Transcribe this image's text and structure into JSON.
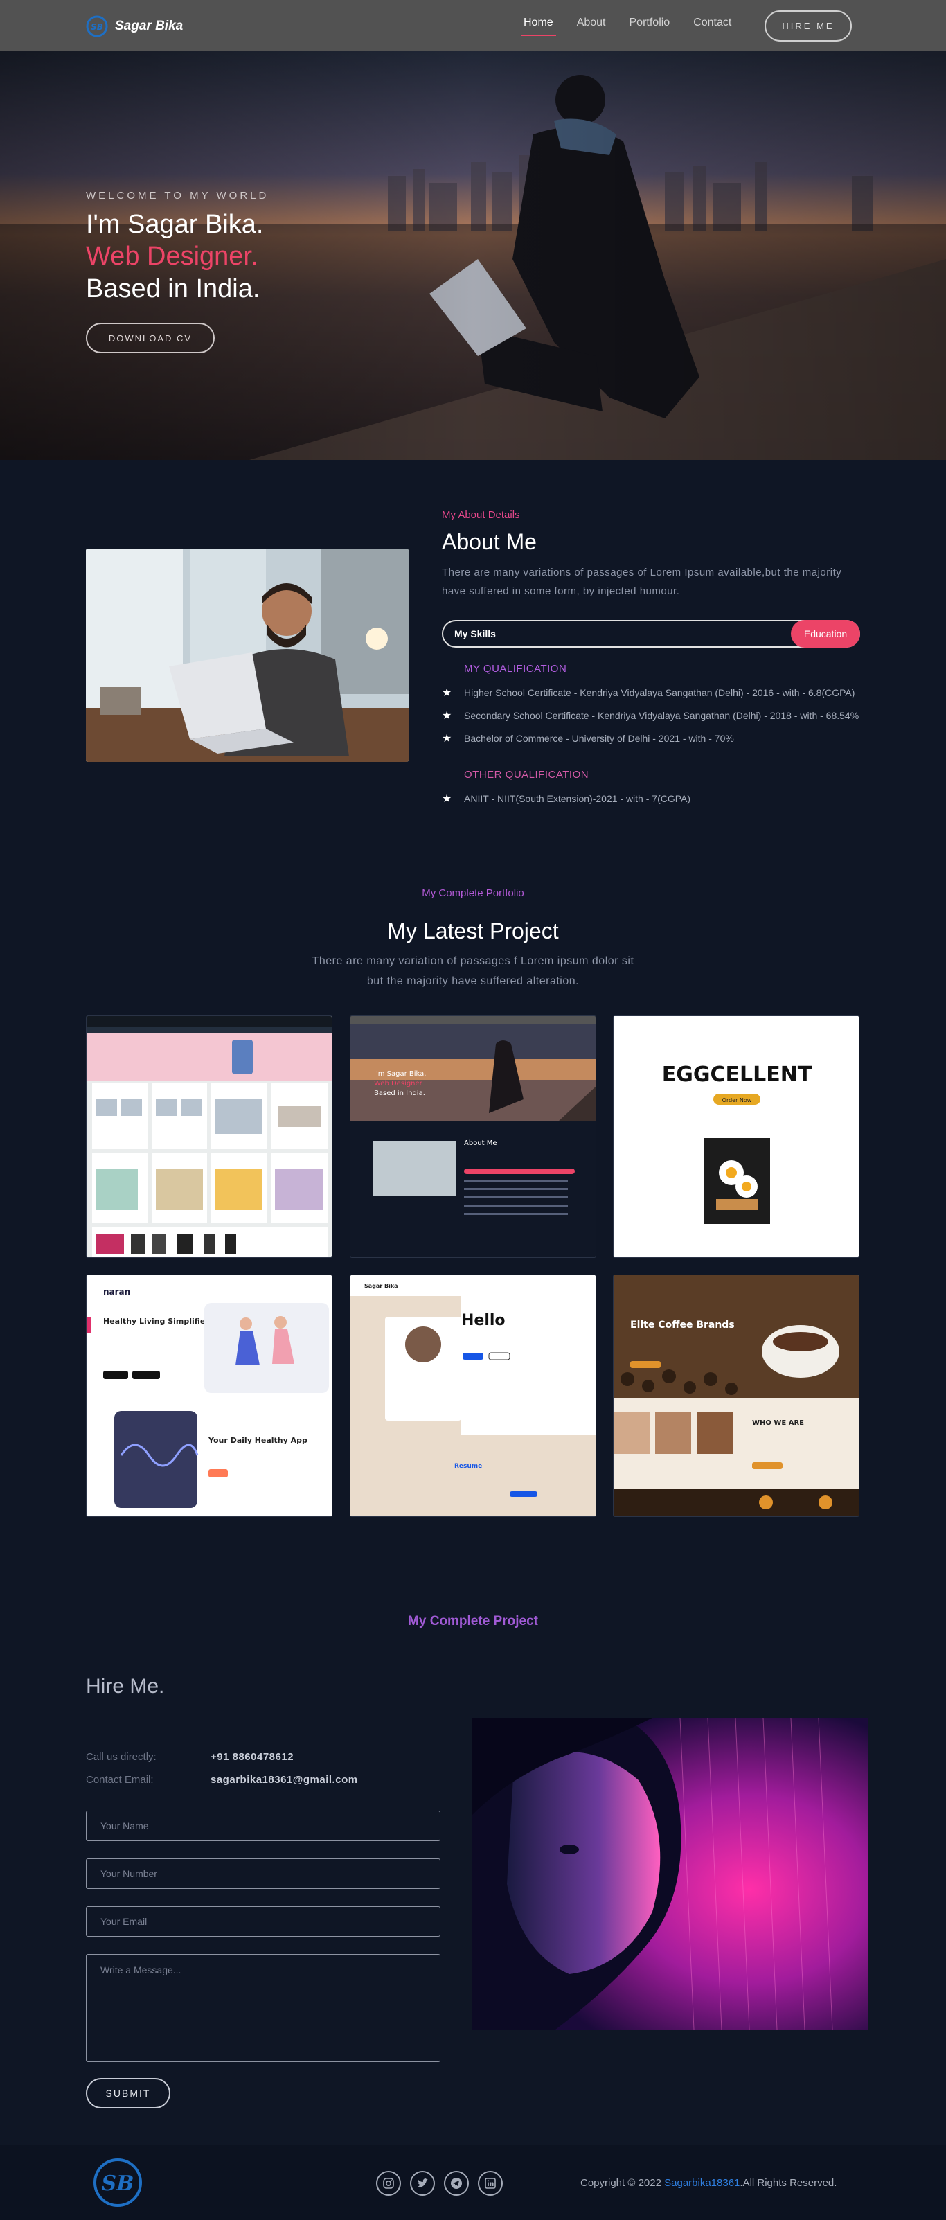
{
  "nav": {
    "brand": "Sagar Bika",
    "links": [
      "Home",
      "About",
      "Portfolio",
      "Contact"
    ],
    "hire_label": "HIRE ME"
  },
  "hero": {
    "welcome": "WELCOME TO MY WORLD",
    "line1": "I'm Sagar Bika.",
    "line2": "Web Designer.",
    "line3": "Based in India.",
    "download_label": "DOWNLOAD CV"
  },
  "about": {
    "subtitle": "My About Details",
    "title": "About Me",
    "description": "There are many variations of passages of Lorem Ipsum available,but the majority have suffered in some form, by injected humour.",
    "skills_label": "My Skills",
    "education_label": "Education",
    "qualification_head": "MY QUALIFICATION",
    "qualifications": [
      "Higher School Certificate - Kendriya Vidyalaya Sangathan (Delhi) - 2016 - with - 6.8(CGPA)",
      "Secondary School Certificate - Kendriya Vidyalaya Sangathan (Delhi) - 2018 - with - 68.54%",
      "Bachelor of Commerce - University of Delhi - 2021 - with - 70%"
    ],
    "other_head": "OTHER QUALIFICATION",
    "other": [
      "ANIIT - NIIT(South Extension)-2021 - with - 7(CGPA)"
    ]
  },
  "portfolio": {
    "subtitle": "My Complete Portfolio",
    "title": "My Latest Project",
    "description_line1": "There are many variation of passages f Lorem ipsum dolor sit",
    "description_line2": "but the majority have suffered alteration.",
    "cards": {
      "p2_name": "I'm Sagar Bika.",
      "p2_role": "Web Designer",
      "p2_loc": "Based in India.",
      "p2_about": "About Me",
      "p3_title": "EGGCELLENT",
      "p3_btn": "Order Now",
      "p4_brand": "naran",
      "p4_title": "Healthy Living Simplified",
      "p4_app": "Your Daily Healthy App",
      "p5_brand": "Sagar Bika",
      "p5_hello": "Hello",
      "p5_resume": "Resume",
      "p6_title": "Elite Coffee Brands",
      "p6_who": "WHO WE ARE"
    }
  },
  "hire": {
    "subtitle": "My Complete Project",
    "title": "Hire Me.",
    "call_label": "Call us directly:",
    "call_value": "+91 8860478612",
    "email_label": "Contact Email:",
    "email_value": "sagarbika18361@gmail.com",
    "name_ph": "Your Name",
    "number_ph": "Your Number",
    "email_ph": "Your Email",
    "message_ph": "Write a Message...",
    "submit_label": "SUBMIT"
  },
  "footer": {
    "copy_prefix": "Copyright © 2022",
    "copy_link": "Sagarbika18361",
    "copy_suffix": ".All Rights Reserved."
  },
  "colors": {
    "accent": "#ec4467",
    "purple": "#b35ad7",
    "bg": "#0f1625",
    "nav": "#525252"
  },
  "icons": [
    "logo-icon",
    "instagram-icon",
    "twitter-icon",
    "telegram-icon",
    "linkedin-icon",
    "star-icon"
  ]
}
